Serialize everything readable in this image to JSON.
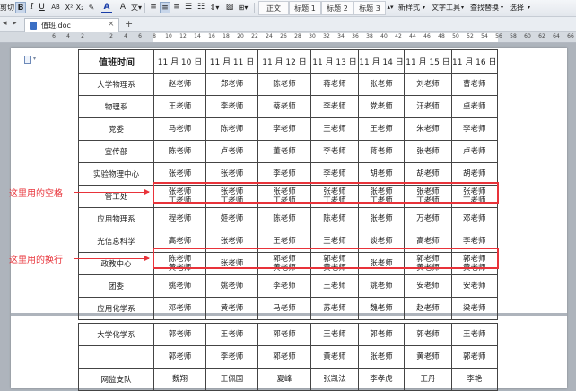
{
  "toolbar": {
    "cut_label": "剪切",
    "font_size_label": "A",
    "abc_label": "AB",
    "styles": [
      "正文",
      "标题 1",
      "标题 2",
      "标题 3"
    ],
    "new_style_label": "新样式",
    "text_tools_label": "文字工具",
    "find_replace_label": "查找替换",
    "select_label": "选择"
  },
  "tabbar": {
    "file_name": "值班.doc"
  },
  "ruler": {
    "numbers": [
      "6",
      "4",
      "2",
      "",
      "2",
      "4",
      "6",
      "8",
      "10",
      "12",
      "14",
      "16",
      "18",
      "20",
      "22",
      "24",
      "26",
      "28",
      "30",
      "32",
      "34",
      "36",
      "38",
      "40",
      "42",
      "44",
      "46",
      "48",
      "50",
      "52",
      "54",
      "56",
      "58",
      "60",
      "62",
      "64",
      "66"
    ]
  },
  "table": {
    "corner": "值班时间",
    "dates": [
      "11 月 10 日",
      "11 月 11 日",
      "11 月 12 日",
      "11 月 13 日",
      "11 月 14 日",
      "11 月 15 日",
      "11 月 16 日"
    ],
    "rows": [
      {
        "dept": "大学物理系",
        "cells": [
          [
            "赵老师"
          ],
          [
            "郑老师"
          ],
          [
            "陈老师"
          ],
          [
            "蒋老师"
          ],
          [
            "张老师"
          ],
          [
            "刘老师"
          ],
          [
            "曹老师"
          ]
        ]
      },
      {
        "dept": "物理系",
        "cells": [
          [
            "王老师"
          ],
          [
            "李老师"
          ],
          [
            "蔡老师"
          ],
          [
            "李老师"
          ],
          [
            "党老师"
          ],
          [
            "汪老师"
          ],
          [
            "卓老师"
          ]
        ]
      },
      {
        "dept": "党委",
        "cells": [
          [
            "马老师"
          ],
          [
            "陈老师"
          ],
          [
            "李老师"
          ],
          [
            "王老师"
          ],
          [
            "王老师"
          ],
          [
            "朱老师"
          ],
          [
            "李老师"
          ]
        ]
      },
      {
        "dept": "宣传部",
        "cells": [
          [
            "陈老师"
          ],
          [
            "卢老师"
          ],
          [
            "董老师"
          ],
          [
            "李老师"
          ],
          [
            "蒋老师"
          ],
          [
            "张老师"
          ],
          [
            "卢老师"
          ]
        ]
      },
      {
        "dept": "实验物理中心",
        "cells": [
          [
            "张老师"
          ],
          [
            "张老师"
          ],
          [
            "李老师"
          ],
          [
            "李老师"
          ],
          [
            "胡老师"
          ],
          [
            "胡老师"
          ],
          [
            "胡老师"
          ]
        ]
      },
      {
        "dept": "管工处",
        "cells": [
          [
            "张老师",
            "丁老师"
          ],
          [
            "张老师",
            "丁老师"
          ],
          [
            "张老师",
            "丁老师"
          ],
          [
            "张老师",
            "丁老师"
          ],
          [
            "张老师",
            "丁老师"
          ],
          [
            "张老师",
            "丁老师"
          ],
          [
            "张老师",
            "丁老师"
          ]
        ]
      },
      {
        "dept": "应用物理系",
        "cells": [
          [
            "程老师"
          ],
          [
            "姬老师"
          ],
          [
            "陈老师"
          ],
          [
            "陈老师"
          ],
          [
            "张老师"
          ],
          [
            "万老师"
          ],
          [
            "邓老师"
          ]
        ]
      },
      {
        "dept": "光信息科学",
        "cells": [
          [
            "",
            "高老师"
          ],
          [
            "张老师"
          ],
          [
            "王老师"
          ],
          [
            "王老师"
          ],
          [
            "谈老师"
          ],
          [
            "",
            "高老师"
          ],
          [
            "李老师"
          ]
        ]
      },
      {
        "dept": "政教中心",
        "cells": [
          [
            "陈老师",
            "黄老师"
          ],
          [
            "张老师"
          ],
          [
            "郭老师",
            "黄老师"
          ],
          [
            "郭老师",
            "黄老师"
          ],
          [
            "张老师"
          ],
          [
            "郭老师",
            "黄老师"
          ],
          [
            "郭老师",
            "黄老师"
          ]
        ]
      },
      {
        "dept": "团委",
        "cells": [
          [
            "姚老师"
          ],
          [
            "姚老师"
          ],
          [
            "李老师"
          ],
          [
            "王老师"
          ],
          [
            "姚老师"
          ],
          [
            "安老师"
          ],
          [
            "安老师"
          ]
        ]
      },
      {
        "dept": "应用化学系",
        "cells": [
          [
            "邓老师"
          ],
          [
            "黄老师"
          ],
          [
            "马老师"
          ],
          [
            "苏老师"
          ],
          [
            "魏老师"
          ],
          [
            "赵老师"
          ],
          [
            "梁老师"
          ]
        ]
      }
    ],
    "rows2": [
      {
        "dept": "大学化学系",
        "cells": [
          [
            "郭老师"
          ],
          [
            "王老师"
          ],
          [
            "郭老师"
          ],
          [
            "王老师"
          ],
          [
            "郭老师"
          ],
          [
            "郭老师"
          ],
          [
            "王老师"
          ]
        ]
      },
      {
        "dept": "",
        "cells": [
          [
            "郭老师"
          ],
          [
            "李老师"
          ],
          [
            "郭老师"
          ],
          [
            "黄老师"
          ],
          [
            "张老师"
          ],
          [
            "黄老师"
          ],
          [
            "郭老师"
          ]
        ]
      },
      {
        "dept": "网监支队",
        "cells": [
          [
            "魏翔"
          ],
          [
            "王佩国"
          ],
          [
            "夏峰"
          ],
          [
            "张凯法"
          ],
          [
            "李孝虎"
          ],
          [
            "王丹"
          ],
          [
            "李艳"
          ]
        ]
      }
    ]
  },
  "annotations": {
    "space_label": "这里用的空格",
    "newline_label": "这里用的换行"
  },
  "colors": {
    "annotation": "#e8333a",
    "toolbar_active": "#c8d6ea",
    "page": "#ffffff"
  }
}
